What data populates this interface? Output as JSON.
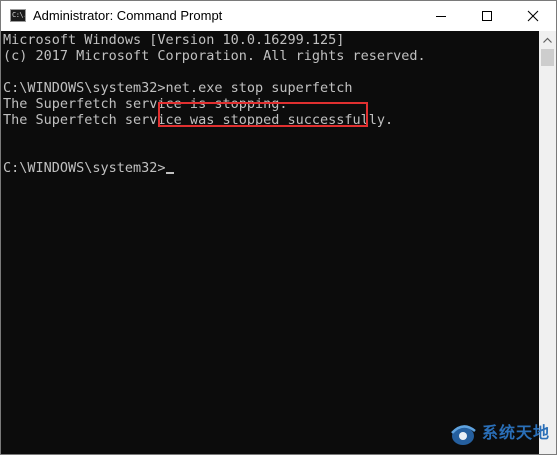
{
  "window": {
    "title": "Administrator: Command Prompt",
    "icon_glyph": "C:\\."
  },
  "console": {
    "lines": [
      "Microsoft Windows [Version 10.0.16299.125]",
      "(c) 2017 Microsoft Corporation. All rights reserved.",
      "C:\\WINDOWS\\system32>net.exe stop superfetch",
      "The Superfetch service is stopping.",
      "The Superfetch service was stopped successfully.",
      "C:\\WINDOWS\\system32>"
    ],
    "highlighted_command": "net.exe stop superfetch",
    "highlight_color": "#e03030",
    "text_color": "#c0c0c0",
    "background_color": "#0c0c0c"
  },
  "icons": {
    "app": "command-prompt-icon",
    "minimize": "minimize-icon",
    "maximize": "maximize-icon",
    "close": "close-icon",
    "scroll_up": "scroll-up-arrow-icon",
    "watermark": "watermark-logo-icon"
  },
  "watermark": {
    "text": "系统天地",
    "color": "#2a6fb8"
  }
}
